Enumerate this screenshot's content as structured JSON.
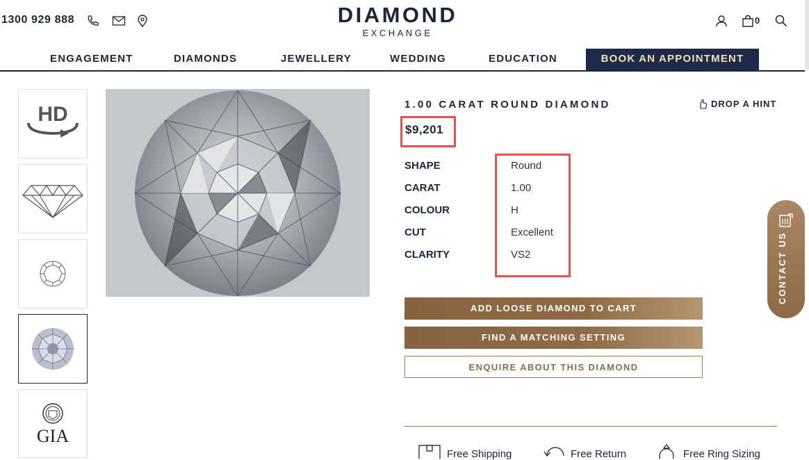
{
  "header": {
    "phone": "1300 929 888",
    "logo_main": "DIAMOND",
    "logo_sub": "EXCHANGE",
    "cart_count": "0",
    "icons": [
      "phone-icon",
      "mail-icon",
      "location-icon",
      "account-icon",
      "bag-icon",
      "search-icon"
    ]
  },
  "nav": {
    "items": [
      "ENGAGEMENT",
      "DIAMONDS",
      "JEWELLERY",
      "WEDDING",
      "EDUCATION"
    ],
    "cta": "BOOK AN APPOINTMENT"
  },
  "gallery": {
    "thumbnails": [
      "hd-360-view",
      "diamond-profile-diagram",
      "diamond-top-diagram",
      "diamond-photo",
      "gia-certificate"
    ],
    "gia_label": "GIA",
    "active_index": 3
  },
  "product": {
    "title": "1.00 CARAT ROUND DIAMOND",
    "hint": "DROP A HINT",
    "price": "$9,201",
    "specs": [
      {
        "label": "SHAPE",
        "value": "Round"
      },
      {
        "label": "CARAT",
        "value": "1.00"
      },
      {
        "label": "COLOUR",
        "value": "H"
      },
      {
        "label": "CUT",
        "value": "Excellent"
      },
      {
        "label": "CLARITY",
        "value": "VS2"
      }
    ],
    "buttons": {
      "add_to_cart": "ADD LOOSE DIAMOND TO CART",
      "find_setting": "FIND A MATCHING SETTING",
      "enquire": "ENQUIRE ABOUT THIS DIAMOND"
    },
    "perks": [
      "Free Shipping",
      "Free Return",
      "Free Ring Sizing"
    ]
  },
  "contact_tab": "CONTACT US",
  "colors": {
    "navy": "#1d2a4a",
    "gold": "#8e6a45",
    "highlight": "#e05552"
  }
}
